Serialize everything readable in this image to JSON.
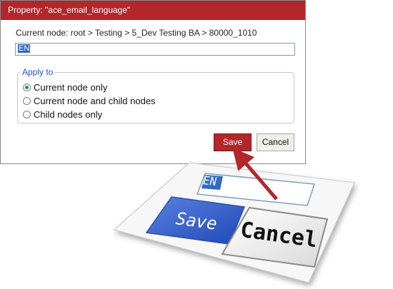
{
  "dialog": {
    "title": "Property: \"ace_email_language\"",
    "path": "Current node: root > Testing > 5_Dev Testing BA > 80000_1010",
    "input_value": "EN",
    "apply_to": {
      "legend": "Apply to",
      "options": [
        {
          "label": "Current node only",
          "selected": true
        },
        {
          "label": "Current node and child nodes",
          "selected": false
        },
        {
          "label": "Child nodes only",
          "selected": false
        }
      ]
    },
    "save_label": "Save",
    "cancel_label": "Cancel"
  },
  "zoom": {
    "input_value": "EN",
    "save_label": "Save",
    "cancel_label": "Cancel"
  },
  "colors": {
    "accent": "#b3262a",
    "selection": "#316ac5",
    "legend": "#2255cc"
  }
}
